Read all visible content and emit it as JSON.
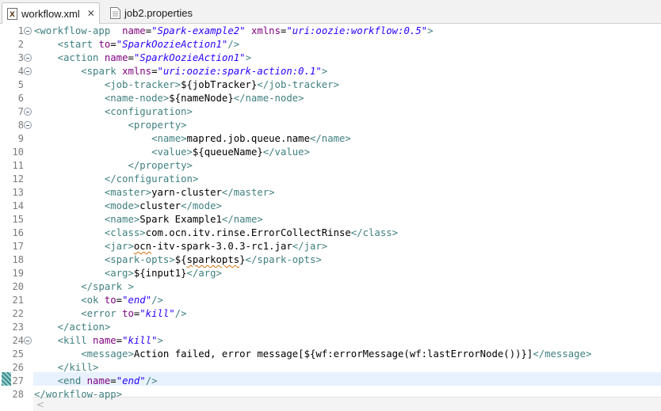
{
  "tabs": [
    {
      "label": "workflow.xml",
      "active": true,
      "icon": "xml-file-icon",
      "close": "✕"
    },
    {
      "label": "job2.properties",
      "active": false,
      "icon": "properties-file-icon"
    }
  ],
  "editor": {
    "current_line": 27,
    "lines": [
      {
        "n": "1",
        "fold": true,
        "indent": 0,
        "tokens": [
          [
            "tg",
            "<workflow-app  "
          ],
          [
            "at",
            "name"
          ],
          [
            "tx",
            "="
          ],
          [
            "av",
            "\"Spark-example2\""
          ],
          [
            "tx",
            " "
          ],
          [
            "at",
            "xmlns"
          ],
          [
            "tx",
            "="
          ],
          [
            "av",
            "\"uri:oozie:workflow:0.5\""
          ],
          [
            "tg",
            ">"
          ]
        ]
      },
      {
        "n": "2",
        "fold": false,
        "indent": 1,
        "tokens": [
          [
            "tg",
            "<start "
          ],
          [
            "at",
            "to"
          ],
          [
            "tx",
            "="
          ],
          [
            "av",
            "\"SparkOozieAction1\""
          ],
          [
            "tg",
            "/>"
          ]
        ]
      },
      {
        "n": "3",
        "fold": true,
        "indent": 1,
        "tokens": [
          [
            "tg",
            "<action "
          ],
          [
            "at",
            "name"
          ],
          [
            "tx",
            "="
          ],
          [
            "av",
            "\"SparkOozieAction1\""
          ],
          [
            "tg",
            ">"
          ]
        ]
      },
      {
        "n": "4",
        "fold": true,
        "indent": 2,
        "tokens": [
          [
            "tg",
            "<spark "
          ],
          [
            "at",
            "xmlns"
          ],
          [
            "tx",
            "="
          ],
          [
            "av",
            "\"uri:oozie:spark-action:0.1\""
          ],
          [
            "tg",
            ">"
          ]
        ]
      },
      {
        "n": "5",
        "fold": false,
        "indent": 3,
        "tokens": [
          [
            "tg",
            "<job-tracker>"
          ],
          [
            "tx",
            "${jobTracker}"
          ],
          [
            "tg",
            "</job-tracker>"
          ]
        ]
      },
      {
        "n": "6",
        "fold": false,
        "indent": 3,
        "tokens": [
          [
            "tg",
            "<name-node>"
          ],
          [
            "tx",
            "${nameNode}"
          ],
          [
            "tg",
            "</name-node>"
          ]
        ]
      },
      {
        "n": "7",
        "fold": true,
        "indent": 3,
        "tokens": [
          [
            "tg",
            "<configuration>"
          ]
        ]
      },
      {
        "n": "8",
        "fold": true,
        "indent": 4,
        "tokens": [
          [
            "tg",
            "<property>"
          ]
        ]
      },
      {
        "n": "9",
        "fold": false,
        "indent": 5,
        "tokens": [
          [
            "tg",
            "<name>"
          ],
          [
            "tx",
            "mapred.job.queue.name"
          ],
          [
            "tg",
            "</name>"
          ]
        ]
      },
      {
        "n": "10",
        "fold": false,
        "indent": 5,
        "tokens": [
          [
            "tg",
            "<value>"
          ],
          [
            "tx",
            "${queueName}"
          ],
          [
            "tg",
            "</value>"
          ]
        ]
      },
      {
        "n": "11",
        "fold": false,
        "indent": 4,
        "tokens": [
          [
            "tg",
            "</property>"
          ]
        ]
      },
      {
        "n": "12",
        "fold": false,
        "indent": 3,
        "tokens": [
          [
            "tg",
            "</configuration>"
          ]
        ]
      },
      {
        "n": "13",
        "fold": false,
        "indent": 3,
        "tokens": [
          [
            "tg",
            "<master>"
          ],
          [
            "tx",
            "yarn-cluster"
          ],
          [
            "tg",
            "</master>"
          ]
        ]
      },
      {
        "n": "14",
        "fold": false,
        "indent": 3,
        "tokens": [
          [
            "tg",
            "<mode>"
          ],
          [
            "tx",
            "cluster"
          ],
          [
            "tg",
            "</mode>"
          ]
        ]
      },
      {
        "n": "15",
        "fold": false,
        "indent": 3,
        "tokens": [
          [
            "tg",
            "<name>"
          ],
          [
            "tx",
            "Spark Example1"
          ],
          [
            "tg",
            "</name>"
          ]
        ]
      },
      {
        "n": "16",
        "fold": false,
        "indent": 3,
        "tokens": [
          [
            "tg",
            "<class>"
          ],
          [
            "tx",
            "com.ocn.itv.rinse.ErrorCollectRinse"
          ],
          [
            "tg",
            "</class>"
          ]
        ]
      },
      {
        "n": "17",
        "fold": false,
        "indent": 3,
        "tokens": [
          [
            "tg",
            "<jar>"
          ],
          [
            "sq",
            "ocn"
          ],
          [
            "tx",
            "-itv-spark-3.0.3-rc1.jar"
          ],
          [
            "tg",
            "</jar>"
          ]
        ]
      },
      {
        "n": "18",
        "fold": false,
        "indent": 3,
        "tokens": [
          [
            "tg",
            "<spark-opts>"
          ],
          [
            "tx",
            "${"
          ],
          [
            "sq",
            "sparkopts"
          ],
          [
            "tx",
            "}"
          ],
          [
            "tg",
            "</spark-opts>"
          ]
        ]
      },
      {
        "n": "19",
        "fold": false,
        "indent": 3,
        "tokens": [
          [
            "tg",
            "<arg>"
          ],
          [
            "tx",
            "${input1}"
          ],
          [
            "tg",
            "</arg>"
          ]
        ]
      },
      {
        "n": "20",
        "fold": false,
        "indent": 2,
        "tokens": [
          [
            "tg",
            "</spark >"
          ]
        ]
      },
      {
        "n": "21",
        "fold": false,
        "indent": 2,
        "tokens": [
          [
            "tg",
            "<ok "
          ],
          [
            "at",
            "to"
          ],
          [
            "tx",
            "="
          ],
          [
            "av",
            "\"end\""
          ],
          [
            "tg",
            "/>"
          ]
        ]
      },
      {
        "n": "22",
        "fold": false,
        "indent": 2,
        "tokens": [
          [
            "tg",
            "<error "
          ],
          [
            "at",
            "to"
          ],
          [
            "tx",
            "="
          ],
          [
            "av",
            "\"kill\""
          ],
          [
            "tg",
            "/>"
          ]
        ]
      },
      {
        "n": "23",
        "fold": false,
        "indent": 1,
        "tokens": [
          [
            "tg",
            "</action>"
          ]
        ]
      },
      {
        "n": "24",
        "fold": true,
        "indent": 1,
        "tokens": [
          [
            "tg",
            "<kill "
          ],
          [
            "at",
            "name"
          ],
          [
            "tx",
            "="
          ],
          [
            "av",
            "\"kill\""
          ],
          [
            "tg",
            ">"
          ]
        ]
      },
      {
        "n": "25",
        "fold": false,
        "indent": 2,
        "tokens": [
          [
            "tg",
            "<message>"
          ],
          [
            "tx",
            "Action failed, error message[${wf:errorMessage(wf:lastErrorNode())}]"
          ],
          [
            "tg",
            "</message>"
          ]
        ]
      },
      {
        "n": "26",
        "fold": false,
        "indent": 1,
        "tokens": [
          [
            "tg",
            "</kill>"
          ]
        ]
      },
      {
        "n": "27",
        "fold": false,
        "indent": 1,
        "tokens": [
          [
            "tg",
            "<end "
          ],
          [
            "at",
            "name"
          ],
          [
            "tx",
            "="
          ],
          [
            "av",
            "\"end\""
          ],
          [
            "tg",
            "/>"
          ]
        ]
      },
      {
        "n": "28",
        "fold": false,
        "indent": 0,
        "tokens": [
          [
            "tg",
            "</workflow-app>"
          ]
        ]
      }
    ]
  },
  "scrollbar": {
    "left_arrow": "<"
  }
}
